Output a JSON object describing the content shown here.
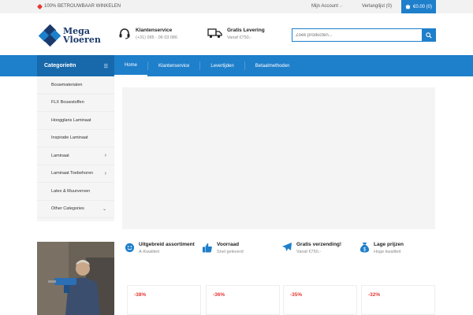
{
  "topbar": {
    "promo": "100% BETROUWBAAR WINKELEN",
    "account": "Mijn Account",
    "wishlist": "Verlanglijst (0)",
    "cart": "€0.00 (0)"
  },
  "header": {
    "logo_line1": "Mega",
    "logo_line2": "Vloeren",
    "service_title": "Klantenservice",
    "service_phone": "(+31) 085 - 06 03 086",
    "delivery_title": "Gratis Levering",
    "delivery_sub": "Vanaf €750,-",
    "search_placeholder": "Zoek producten..."
  },
  "nav": {
    "categories_label": "Categorieën",
    "items": [
      {
        "label": "Home"
      },
      {
        "label": "Klantenservice"
      },
      {
        "label": "Levertijden"
      },
      {
        "label": "Betaalmethoden"
      }
    ]
  },
  "sidebar": {
    "items": [
      {
        "label": "Bouwmaterialen"
      },
      {
        "label": "FLX Bouwstoffen"
      },
      {
        "label": "Hoogglans Laminaat"
      },
      {
        "label": "Inspiratie Laminaat"
      },
      {
        "label": "Laminaat"
      },
      {
        "label": "Laminaat Toebehoren"
      },
      {
        "label": "Latex & Muurverven"
      },
      {
        "label": "Other Categories"
      }
    ]
  },
  "features": [
    {
      "title": "Uitgebreid assortiment",
      "sub": "A-Kwaliteit",
      "icon": "smiley-icon"
    },
    {
      "title": "Voorraad",
      "sub": "Snel geleverd",
      "icon": "thumbs-up-icon"
    },
    {
      "title": "Gratis verzending!",
      "sub": "Vanaf €750,-",
      "icon": "airplane-icon"
    },
    {
      "title": "Lage prijzen",
      "sub": "Hoge kwaliteit",
      "icon": "money-bag-icon"
    }
  ],
  "products": [
    {
      "discount": "-38%"
    },
    {
      "discount": "-36%"
    },
    {
      "discount": "-35%"
    },
    {
      "discount": "-32%"
    }
  ],
  "colors": {
    "primary": "#1e7fcb",
    "primary_dark": "#1769ab",
    "sale": "#e53935"
  }
}
